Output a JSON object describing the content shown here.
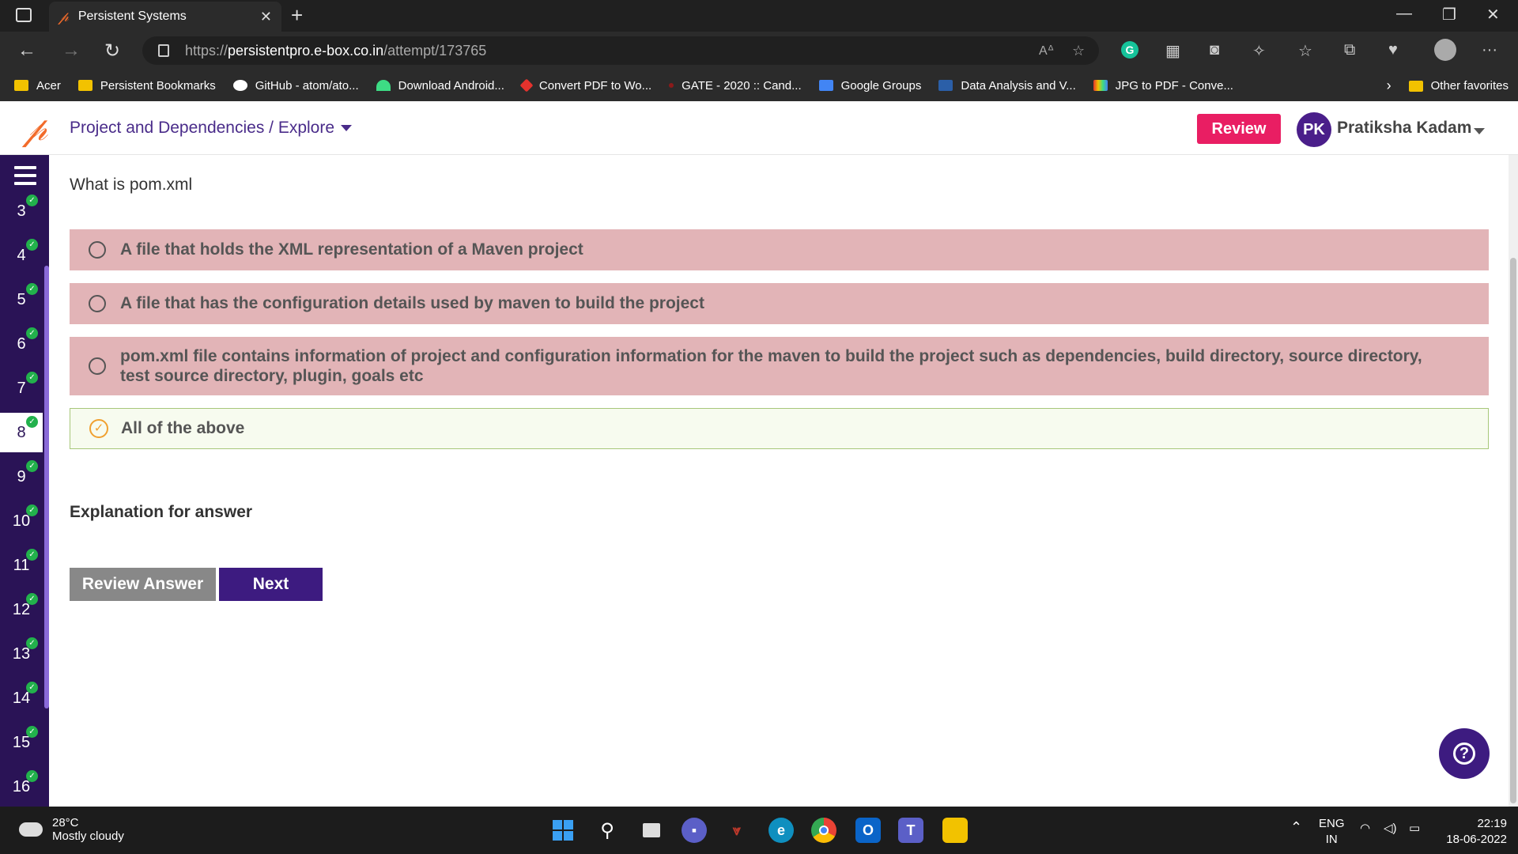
{
  "browser": {
    "tab_title": "Persistent Systems",
    "url_prefix": "https://",
    "url_domain": "persistentpro.e-box.co.in",
    "url_path": "/attempt/173765",
    "bookmarks": [
      {
        "label": "Acer",
        "color": "#f2c200"
      },
      {
        "label": "Persistent Bookmarks",
        "color": "#f2c200"
      },
      {
        "label": "GitHub - atom/ato...",
        "color": "#ffffff"
      },
      {
        "label": "Download Android...",
        "color": "#3ddc84"
      },
      {
        "label": "Convert PDF to Wo...",
        "color": "#e5322d"
      },
      {
        "label": "GATE - 2020 :: Cand...",
        "color": "#8b1a1a"
      },
      {
        "label": "Google Groups",
        "color": "#4285f4"
      },
      {
        "label": "Data Analysis and V...",
        "color": "#2b5fa8"
      },
      {
        "label": "JPG to PDF - Conve...",
        "color": "#e8a317"
      }
    ],
    "other_favorites": "Other favorites"
  },
  "header": {
    "breadcrumb": "Project and Dependencies / Explore",
    "review_label": "Review",
    "avatar_initials": "PK",
    "user_name": "Pratiksha Kadam"
  },
  "sidebar": {
    "questions": [
      {
        "num": "3",
        "done": true
      },
      {
        "num": "4",
        "done": true
      },
      {
        "num": "5",
        "done": true
      },
      {
        "num": "6",
        "done": true
      },
      {
        "num": "7",
        "done": true
      },
      {
        "num": "8",
        "done": true,
        "active": true
      },
      {
        "num": "9",
        "done": true
      },
      {
        "num": "10",
        "done": true
      },
      {
        "num": "11",
        "done": true
      },
      {
        "num": "12",
        "done": true
      },
      {
        "num": "13",
        "done": true
      },
      {
        "num": "14",
        "done": true
      },
      {
        "num": "15",
        "done": true
      },
      {
        "num": "16",
        "done": true
      }
    ]
  },
  "quiz": {
    "question": "What is pom.xml",
    "options": [
      {
        "text": "A file that holds the XML representation of a Maven project",
        "correct": false
      },
      {
        "text": "A file that has the configuration details used by maven to build the project",
        "correct": false
      },
      {
        "text": "pom.xml file contains information of project and configuration information for the maven to build the project such as dependencies, build directory, source directory, test source directory, plugin, goals etc",
        "correct": false
      },
      {
        "text": "All of the above",
        "correct": true
      }
    ],
    "explanation_label": "Explanation for answer",
    "review_answer_label": "Review Answer",
    "next_label": "Next"
  },
  "taskbar": {
    "temperature": "28°C",
    "weather": "Mostly cloudy",
    "lang_top": "ENG",
    "lang_bottom": "IN",
    "time": "22:19",
    "date": "18-06-2022"
  },
  "colors": {
    "brand_purple": "#3d1b80",
    "sidebar_purple": "#2a1356",
    "review_pink": "#e91e63",
    "wrong_option": "#e2b4b7",
    "correct_option": "#f7fbef"
  }
}
